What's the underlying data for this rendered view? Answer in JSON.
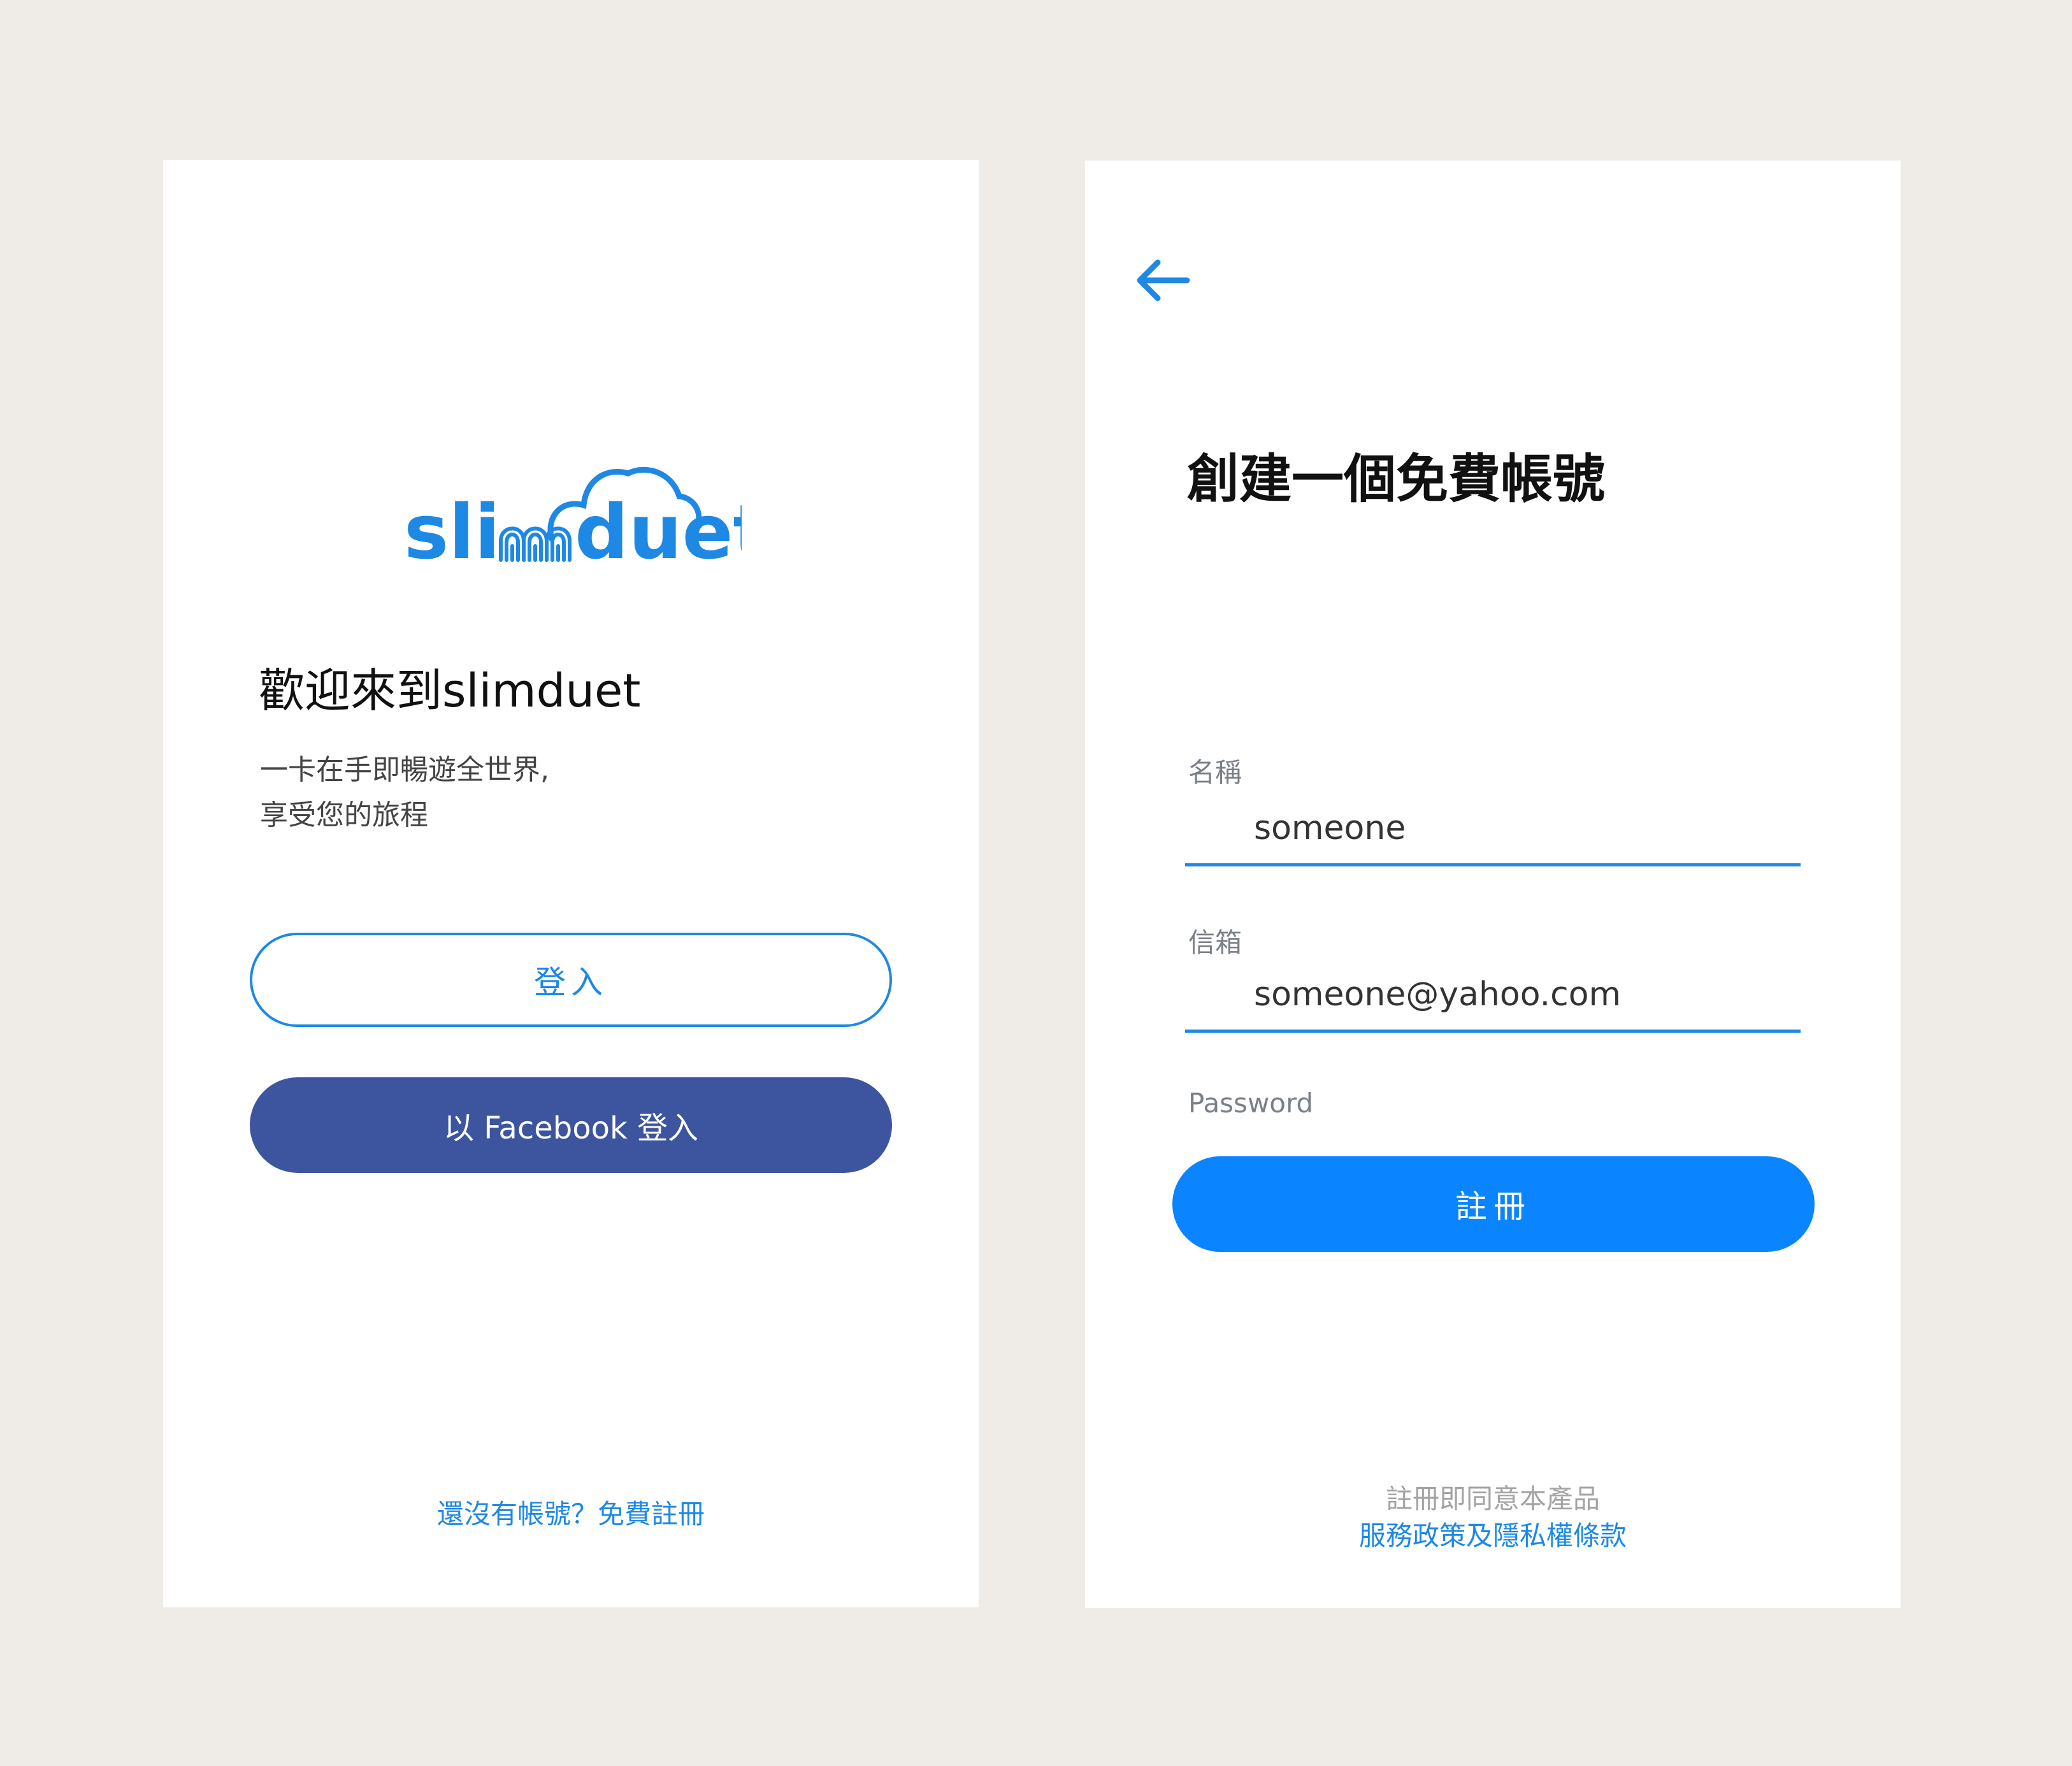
{
  "colors": {
    "background": "#efece7",
    "brand_blue": "#1e88e5",
    "facebook_blue": "#3d559f",
    "primary_button": "#0a84ff",
    "label_gray": "#7a7f88",
    "muted_gray": "#a3a3a3"
  },
  "welcome": {
    "logo_text": "slimduet",
    "title": "歡迎來到slimduet",
    "subtitle_line1": "一卡在手即暢遊全世界,",
    "subtitle_line2": "享受您的旅程",
    "login_label": "登入",
    "facebook_login_label": "以 Facebook 登入",
    "register_link": "還沒有帳號？免費註冊"
  },
  "signup": {
    "back_icon": "arrow-left-icon",
    "title": "創建一個免費帳號",
    "name_label": "名稱",
    "name_value": "someone",
    "email_label": "信箱",
    "email_value": "someone@yahoo.com",
    "password_label": "Password",
    "password_value": "••••••••••",
    "show_password_icon": "eye-icon",
    "submit_label": "註冊",
    "terms_prefix": "註冊即同意本產品",
    "terms_link": "服務政策及隱私權條款"
  }
}
